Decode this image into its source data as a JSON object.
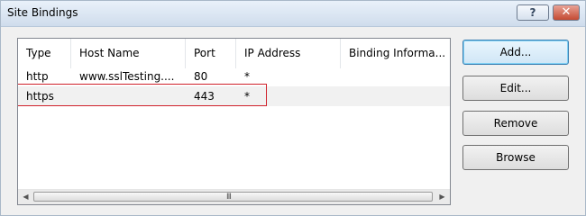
{
  "window": {
    "title": "Site Bindings",
    "help_label": "?",
    "close_label": "✕"
  },
  "table": {
    "columns": [
      "Type",
      "Host Name",
      "Port",
      "IP Address",
      "Binding Informa..."
    ],
    "rows": [
      {
        "type": "http",
        "host": "www.sslTesting....",
        "port": "80",
        "ip": "*",
        "binding": ""
      },
      {
        "type": "https",
        "host": "",
        "port": "443",
        "ip": "*",
        "binding": ""
      }
    ]
  },
  "scrollbar": {
    "left_arrow": "◀",
    "right_arrow": "▶",
    "grip": "III"
  },
  "buttons": {
    "add": "Add...",
    "edit": "Edit...",
    "remove": "Remove",
    "browse": "Browse"
  },
  "colors": {
    "highlight": "#d0212b",
    "default_button_border": "#3c7fb1"
  }
}
